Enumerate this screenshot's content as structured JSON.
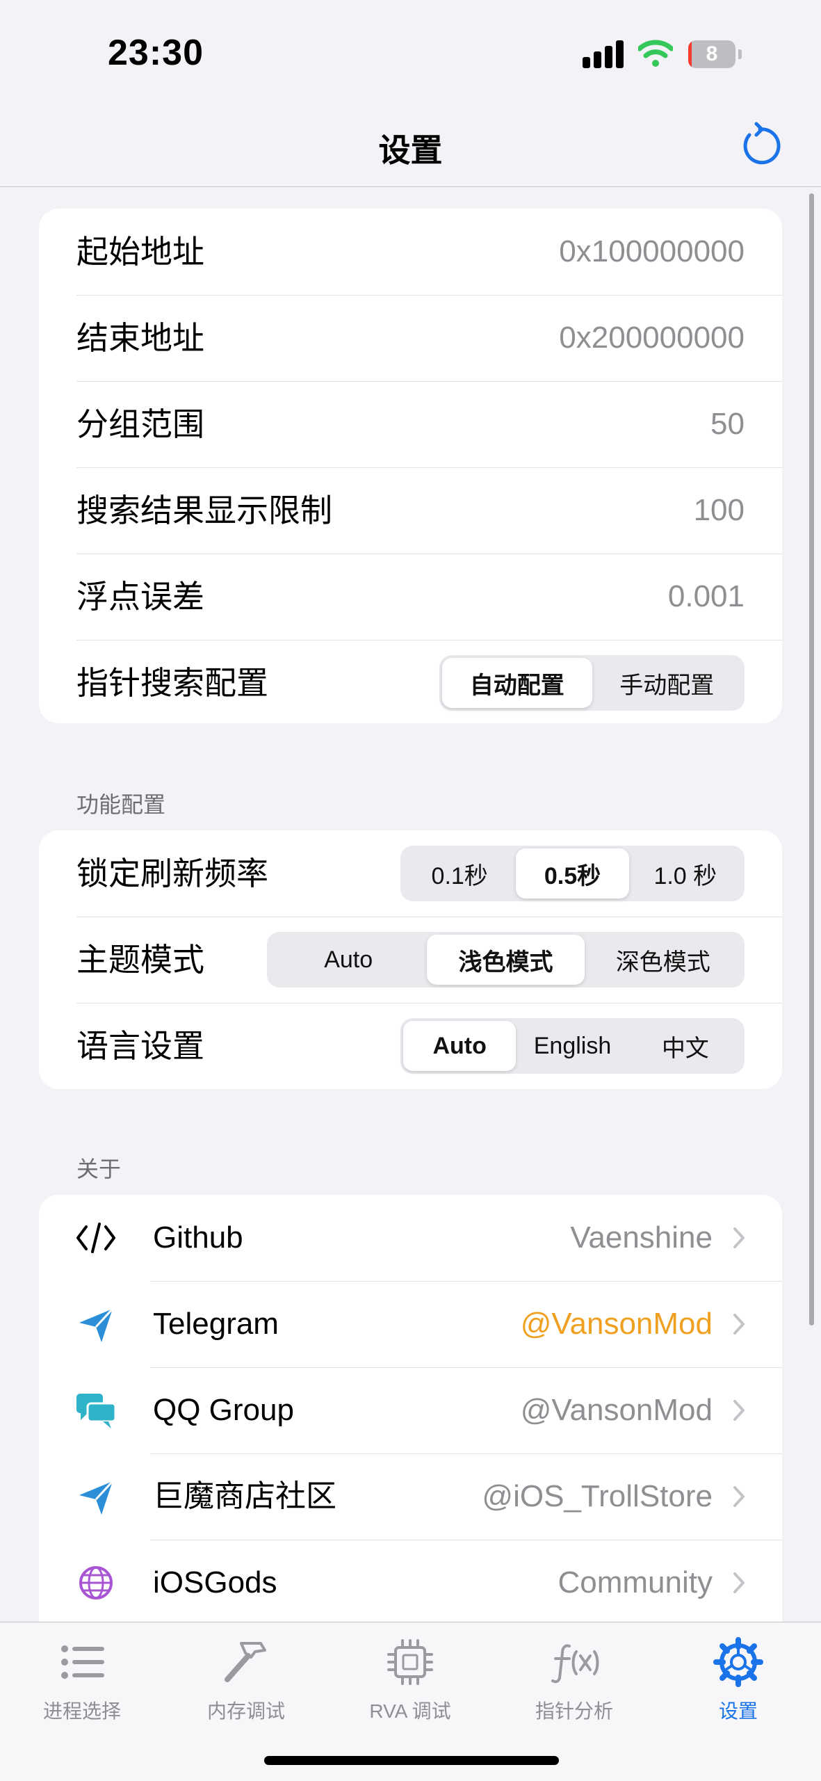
{
  "status_bar": {
    "time": "23:30",
    "battery_level": "8",
    "battery_fraction": 0.08
  },
  "nav": {
    "title": "设置",
    "reset_icon": "reset-icon"
  },
  "settings": [
    {
      "label": "起始地址",
      "value": "0x100000000"
    },
    {
      "label": "结束地址",
      "value": "0x200000000"
    },
    {
      "label": "分组范围",
      "value": "50"
    },
    {
      "label": "搜索结果显示限制",
      "value": "100"
    },
    {
      "label": "浮点误差",
      "value": "0.001"
    }
  ],
  "pointer_config": {
    "label": "指针搜索配置",
    "options": [
      "自动配置",
      "手动配置"
    ],
    "selected": "自动配置"
  },
  "features": {
    "header": "功能配置",
    "refresh": {
      "label": "锁定刷新频率",
      "options": [
        "0.1秒",
        "0.5秒",
        "1.0 秒"
      ],
      "selected": "0.5秒"
    },
    "theme": {
      "label": "主题模式",
      "options": [
        "Auto",
        "浅色模式",
        "深色模式"
      ],
      "selected": "浅色模式"
    },
    "language": {
      "label": "语言设置",
      "options": [
        "Auto",
        "English",
        "中文"
      ],
      "selected": "Auto"
    }
  },
  "about": {
    "header": "关于",
    "links": [
      {
        "icon": "code-icon",
        "label": "Github",
        "value": "Vaenshine",
        "value_color": "#8e8e93"
      },
      {
        "icon": "paper-plane-icon",
        "label": "Telegram",
        "value": "@VansonMod",
        "value_color": "#f0a020"
      },
      {
        "icon": "chat-bubbles-icon",
        "label": "QQ Group",
        "value": "@VansonMod",
        "value_color": "#8e8e93"
      },
      {
        "icon": "paper-plane-icon",
        "label": "巨魔商店社区",
        "value": "@iOS_TrollStore",
        "value_color": "#8e8e93"
      },
      {
        "icon": "globe-icon",
        "label": "iOSGods",
        "value": "Community",
        "value_color": "#8e8e93"
      }
    ]
  },
  "tabs": [
    {
      "label": "进程选择",
      "icon": "list-icon"
    },
    {
      "label": "内存调试",
      "icon": "hammer-icon"
    },
    {
      "label": "RVA 调试",
      "icon": "cpu-icon"
    },
    {
      "label": "指针分析",
      "icon": "function-icon"
    },
    {
      "label": "设置",
      "icon": "gear-icon",
      "active": true
    }
  ],
  "colors": {
    "accent": "#1a73e8",
    "telegram": "#2a8fd8",
    "qq": "#2eb3c9",
    "globe": "#a855d4",
    "battery": "#ff3b30"
  }
}
